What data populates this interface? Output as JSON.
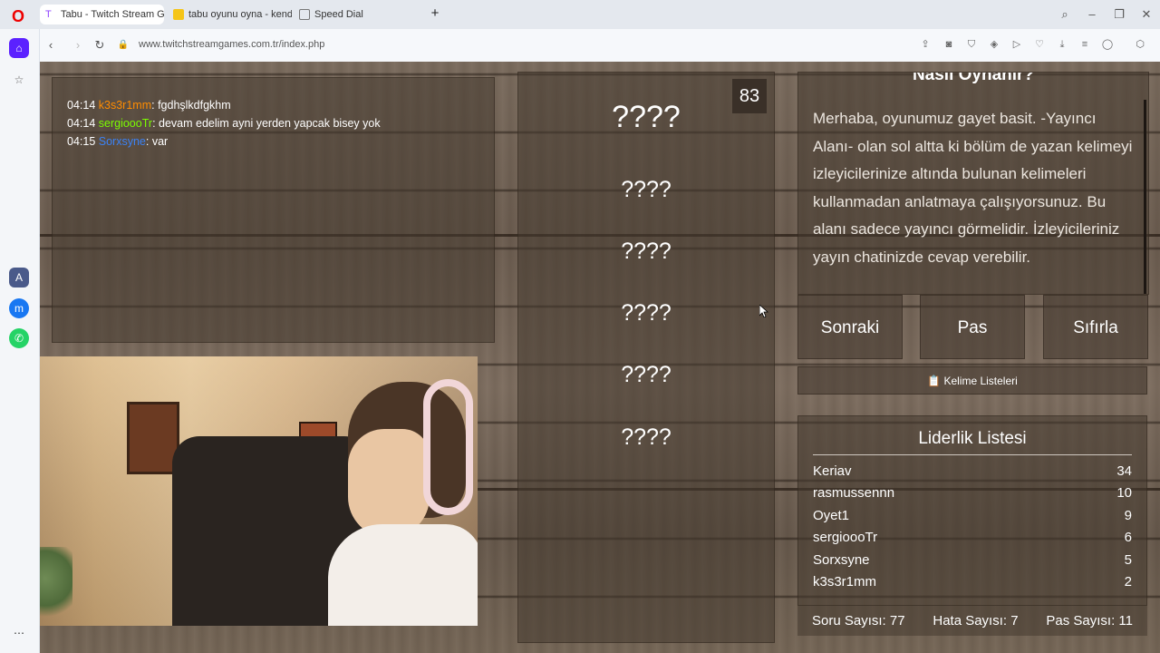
{
  "browser": {
    "tabs": [
      {
        "title": "Tabu - Twitch Stream Gam",
        "active": true
      },
      {
        "title": "tabu oyunu oyna - kendi o",
        "active": false
      },
      {
        "title": "Speed Dial",
        "active": false
      }
    ],
    "url": "www.twitchstreamgames.com.tr/index.php"
  },
  "chat": {
    "messages": [
      {
        "time": "04:14",
        "user": "k3s3r1mm",
        "color": "#ff8c00",
        "text": "fgdhşlkdfgkhm"
      },
      {
        "time": "04:14",
        "user": "sergioooTr",
        "color": "#7cfc00",
        "text": "devam edelim ayni yerden yapcak bisey yok"
      },
      {
        "time": "04:15",
        "user": "Sorxsyne",
        "color": "#3b82f6",
        "text": "var"
      }
    ]
  },
  "card": {
    "timer": "83",
    "main_word": "????",
    "forbidden": [
      "????",
      "????",
      "????",
      "????",
      "????"
    ]
  },
  "howto": {
    "title": "Nasıl Oynanır?",
    "text": "Merhaba, oyunumuz gayet basit. -Yayıncı Alanı- olan sol altta ki bölüm de yazan kelimeyi izleyicilerinize altında bulunan kelimeleri kullanmadan anlatmaya çalışıyorsunuz. Bu alanı sadece yayıncı görmelidir. İzleyicileriniz yayın chatinizde cevap verebilir."
  },
  "buttons": {
    "next": "Sonraki",
    "pass": "Pas",
    "reset": "Sıfırla",
    "word_lists": "📋 Kelime Listeleri"
  },
  "leaderboard": {
    "title": "Liderlik Listesi",
    "rows": [
      {
        "name": "Keriav",
        "score": "34"
      },
      {
        "name": "rasmussennn",
        "score": "10"
      },
      {
        "name": "Oyet1",
        "score": "9"
      },
      {
        "name": "sergioooTr",
        "score": "6"
      },
      {
        "name": "Sorxsyne",
        "score": "5"
      },
      {
        "name": "k3s3r1mm",
        "score": "2"
      }
    ]
  },
  "stats": {
    "questions": "Soru Sayısı: 77",
    "errors": "Hata Sayısı: 7",
    "passes": "Pas Sayısı: 11"
  }
}
